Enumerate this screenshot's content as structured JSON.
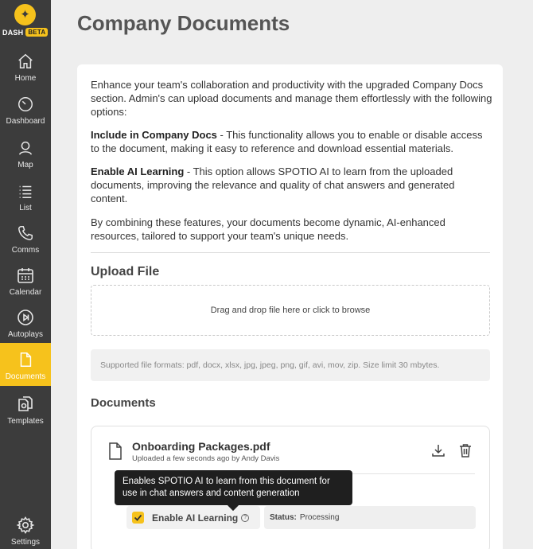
{
  "brand": {
    "logo_glyph": "✦",
    "name": "DASH",
    "badge": "BETA",
    "color": "#f6c21c"
  },
  "sidebar": {
    "items": [
      {
        "label": "Home",
        "icon": "home-icon",
        "active": false
      },
      {
        "label": "Dashboard",
        "icon": "gauge-icon",
        "active": false
      },
      {
        "label": "Map",
        "icon": "map-pin-icon",
        "active": false
      },
      {
        "label": "List",
        "icon": "list-icon",
        "active": false
      },
      {
        "label": "Comms",
        "icon": "phone-icon",
        "active": false
      },
      {
        "label": "Calendar",
        "icon": "calendar-icon",
        "active": false
      },
      {
        "label": "Autoplays",
        "icon": "play-circle-icon",
        "active": false
      },
      {
        "label": "Documents",
        "icon": "document-icon",
        "active": true
      },
      {
        "label": "Templates",
        "icon": "templates-icon",
        "active": false
      },
      {
        "label": "Settings",
        "icon": "gear-icon",
        "active": false
      }
    ]
  },
  "page": {
    "title": "Company Documents"
  },
  "intro": {
    "p1": "Enhance your team's collaboration and productivity with the upgraded Company Docs section. Admin's can upload documents and manage them effortlessly with the following options:",
    "p2_bold": "Include in Company Docs",
    "p2_rest": " - This functionality allows you to enable or disable access to the document, making it easy to reference and download essential materials.",
    "p3_bold": "Enable AI Learning",
    "p3_rest": " - This option allows SPOTIO AI to learn from the uploaded documents, improving the relevance and quality of chat answers and generated content.",
    "p4": "By combining these features, your documents become dynamic, AI-enhanced resources, tailored to support your team's unique needs."
  },
  "upload": {
    "heading": "Upload File",
    "dropzone_text": "Drag and drop file here or click to browse",
    "formats_text": "Supported file formats: pdf, docx, xlsx, jpg, jpeg, png, gif, avi, mov, zip. Size limit 30 mbytes."
  },
  "documents": {
    "heading": "Documents",
    "items": [
      {
        "name": "Onboarding Packages.pdf",
        "meta": "Uploaded a few seconds ago by Andy Davis",
        "ai_learning_label": "Enable AI Learning",
        "ai_learning_checked": true,
        "status_label": "Status:",
        "status_value": "Processing"
      }
    ]
  },
  "tooltip": {
    "text": "Enables SPOTIO AI to learn from this document for use in chat answers and content generation"
  }
}
